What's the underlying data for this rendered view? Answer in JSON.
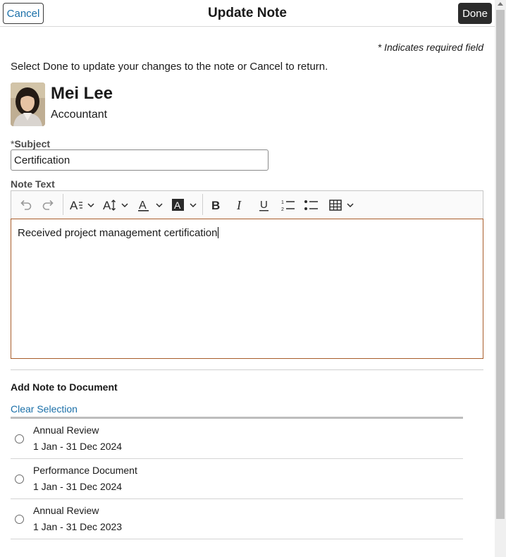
{
  "header": {
    "cancel_label": "Cancel",
    "title": "Update Note",
    "done_label": "Done"
  },
  "required_note": "* Indicates required field",
  "instructions": "Select Done to update your changes to the note or Cancel to return.",
  "person": {
    "name": "Mei Lee",
    "role": "Accountant"
  },
  "subject": {
    "asterisk": "*",
    "label": "Subject",
    "value": "Certification"
  },
  "note_text": {
    "label": "Note Text",
    "content": "Received project management certification"
  },
  "toolbar_icons": [
    "undo-icon",
    "redo-icon",
    "paragraph-format-icon",
    "font-size-icon",
    "text-color-icon",
    "background-color-icon",
    "bold-icon",
    "italic-icon",
    "underline-icon",
    "numbered-list-icon",
    "bulleted-list-icon",
    "table-icon"
  ],
  "documents": {
    "heading": "Add Note to Document",
    "clear_label": "Clear Selection",
    "items": [
      {
        "title": "Annual Review",
        "dates": "1 Jan - 31 Dec 2024"
      },
      {
        "title": "Performance Document",
        "dates": "1 Jan - 31 Dec 2024"
      },
      {
        "title": "Annual Review",
        "dates": "1 Jan - 31 Dec 2023"
      }
    ]
  },
  "colors": {
    "link": "#1a6fa8",
    "done_bg": "#2b2b2b",
    "editor_focus_border": "#a85d2a"
  }
}
